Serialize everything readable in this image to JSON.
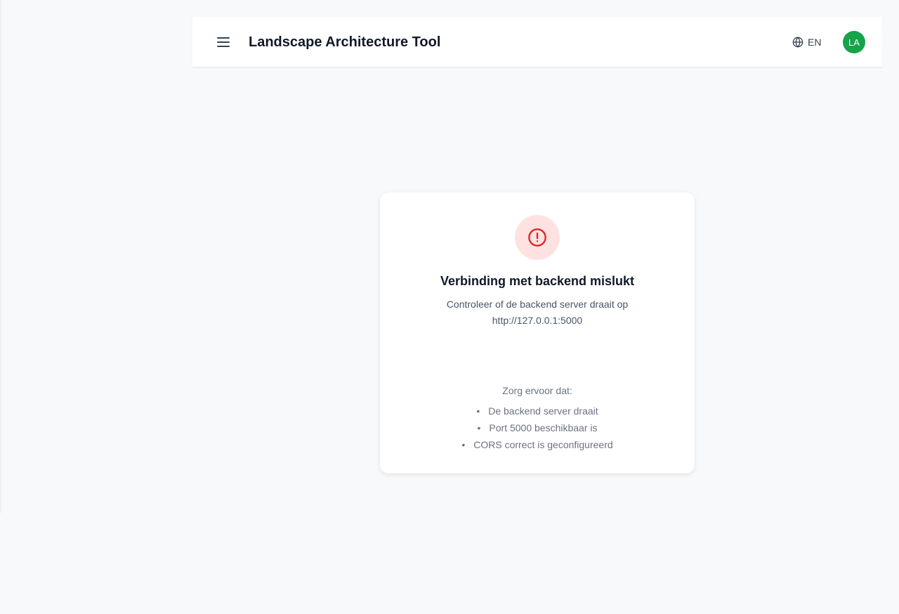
{
  "header": {
    "title": "Landscape Architecture Tool",
    "menu_icon": "hamburger-menu-icon",
    "language": {
      "icon": "globe-icon",
      "label": "EN"
    },
    "avatar": {
      "initials": "LA",
      "color": "#16a34a"
    }
  },
  "error": {
    "icon": "alert-circle-icon",
    "icon_color": "#dc2626",
    "icon_bg": "#fee2e2",
    "title": "Verbinding met backend mislukt",
    "message_line1": "Controleer of de backend server draait op",
    "message_line2": "http://127.0.0.1:5000",
    "hint_intro": "Zorg ervoor dat:",
    "hints": [
      "De backend server draait",
      "Port 5000 beschikbaar is",
      "CORS correct is geconfigureerd"
    ]
  }
}
